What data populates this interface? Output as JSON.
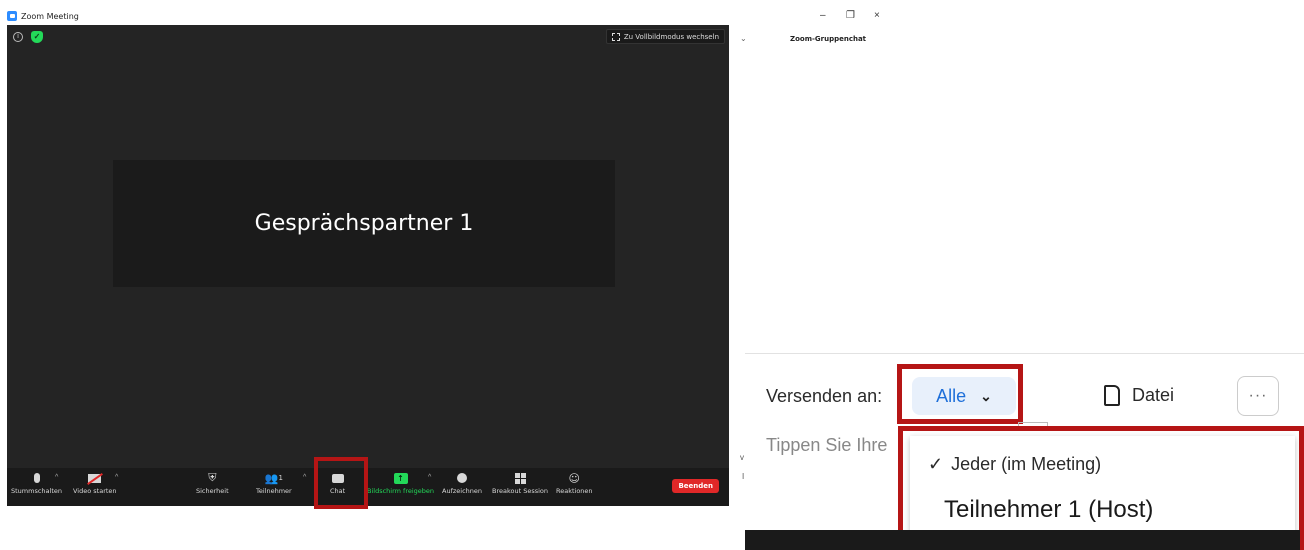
{
  "window": {
    "title": "Zoom Meeting"
  },
  "meeting": {
    "fullscreen_label": "Zu Vollbildmodus wechseln",
    "participant_name": "Gesprächspartner 1",
    "participant_count": "1",
    "toolbar": {
      "mute": "Stummschalten",
      "video": "Video starten",
      "security": "Sicherheit",
      "participants": "Teilnehmer",
      "chat": "Chat",
      "share": "Bildschirm freigeben",
      "record": "Aufzeichnen",
      "breakout": "Breakout Session",
      "reactions": "Reaktionen",
      "end": "Beenden"
    }
  },
  "chat": {
    "title": "Zoom-Gruppenchat",
    "send_to_label": "Versenden an:",
    "recipient_selected": "Alle",
    "file_label": "Datei",
    "more_label": "···",
    "input_placeholder": "Tippen Sie Ihre",
    "dropdown_options": [
      "Jeder (im Meeting)",
      "Teilnehmer 1 (Host)"
    ]
  },
  "colors": {
    "accent": "#2d8cff",
    "highlight": "#b51515",
    "end_button": "#e02828",
    "share_green": "#23d959"
  }
}
